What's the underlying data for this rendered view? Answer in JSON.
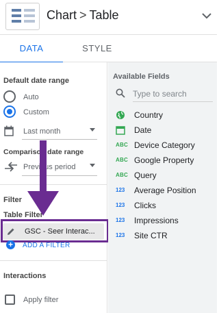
{
  "header": {
    "component_type": "Chart",
    "separator": ">",
    "chart_name": "Table"
  },
  "tabs": [
    {
      "label": "DATA",
      "active": true
    },
    {
      "label": "STYLE",
      "active": false
    }
  ],
  "date_range": {
    "title": "Default date range",
    "options": [
      {
        "label": "Auto",
        "selected": false
      },
      {
        "label": "Custom",
        "selected": true
      }
    ],
    "custom_value": "Last month"
  },
  "comparison": {
    "title": "Comparison date range",
    "value": "Previous period"
  },
  "filter": {
    "title": "Filter",
    "subtitle": "Table Filter",
    "applied_filter": "GSC - Seer Interac...",
    "add_label": "ADD A FILTER"
  },
  "interactions": {
    "title": "Interactions",
    "apply_filter_label": "Apply filter",
    "apply_filter_checked": false
  },
  "available_fields": {
    "title": "Available Fields",
    "search_placeholder": "Type to search",
    "fields": [
      {
        "name": "Country",
        "type": "geo",
        "icon": "globe-icon"
      },
      {
        "name": "Date",
        "type": "date",
        "icon": "calendar-icon"
      },
      {
        "name": "Device Category",
        "type": "text",
        "icon_text": "ABC"
      },
      {
        "name": "Google Property",
        "type": "text",
        "icon_text": "ABC"
      },
      {
        "name": "Query",
        "type": "text",
        "icon_text": "ABC"
      },
      {
        "name": "Average Position",
        "type": "number",
        "icon_text": "123"
      },
      {
        "name": "Clicks",
        "type": "number",
        "icon_text": "123"
      },
      {
        "name": "Impressions",
        "type": "number",
        "icon_text": "123"
      },
      {
        "name": "Site CTR",
        "type": "number",
        "icon_text": "123"
      }
    ]
  },
  "colors": {
    "accent": "#1a73e8",
    "dimension_green": "#34a853",
    "annotation_purple": "#6a2c91"
  }
}
